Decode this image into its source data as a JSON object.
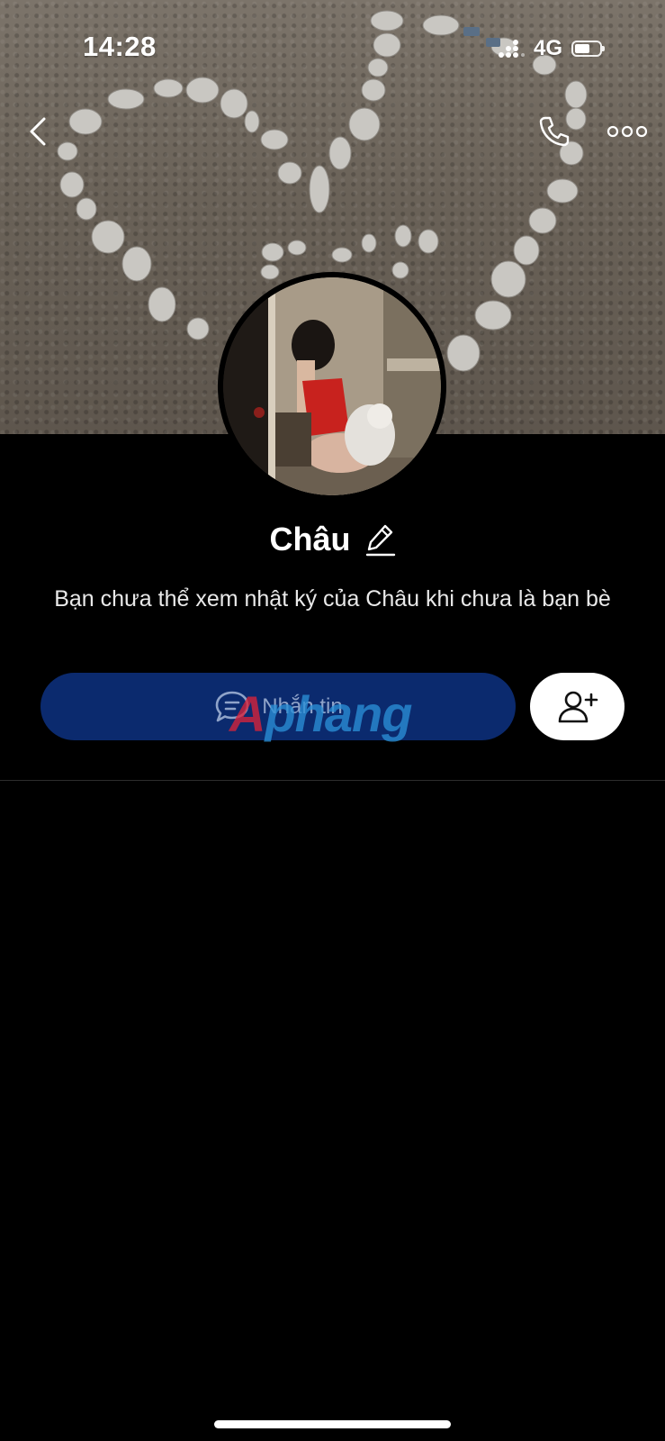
{
  "status_bar": {
    "time": "14:28",
    "network": "4G"
  },
  "header": {
    "back_icon": "chevron-left-icon",
    "call_icon": "phone-icon",
    "more_icon": "more-dots-icon"
  },
  "profile": {
    "name": "Châu",
    "notice": "Bạn chưa thể xem nhật ký của Châu khi chưa là bạn bè"
  },
  "actions": {
    "message_label": "Nhắn tin",
    "message_icon": "chat-bubble-icon",
    "add_friend_icon": "add-friend-icon"
  },
  "watermark": {
    "first": "A",
    "rest": "phang"
  },
  "colors": {
    "background": "#000000",
    "message_button": "#0b2a6e",
    "add_friend_button": "#ffffff"
  }
}
